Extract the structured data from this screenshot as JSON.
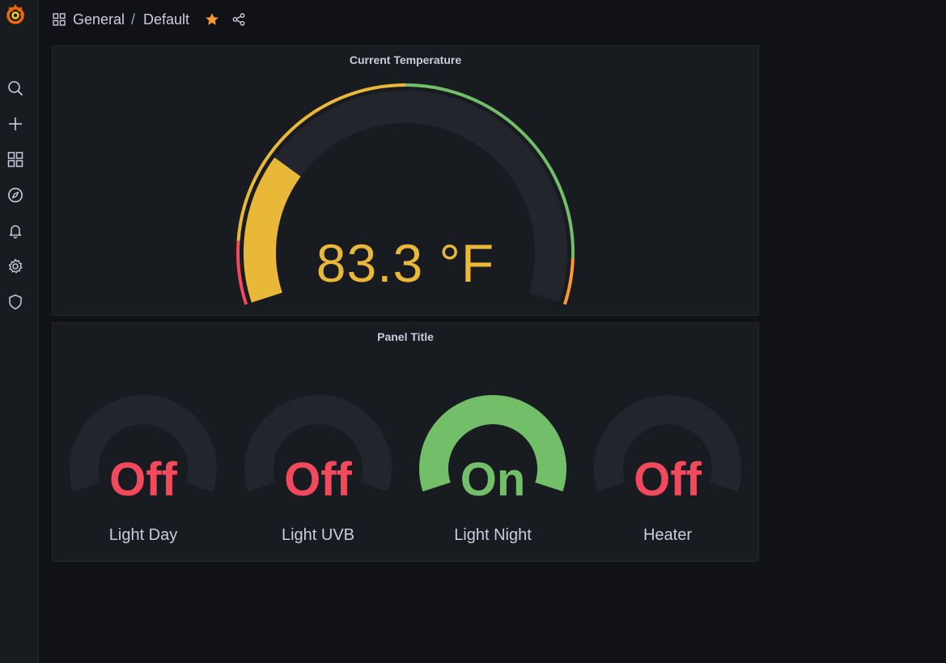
{
  "breadcrumb": {
    "folder": "General",
    "separator": "/",
    "dashboard": "Default"
  },
  "sidebar": {
    "items": [
      {
        "name": "search-icon"
      },
      {
        "name": "plus-icon"
      },
      {
        "name": "dashboards-icon"
      },
      {
        "name": "explore-icon"
      },
      {
        "name": "bell-icon"
      },
      {
        "name": "gear-icon"
      },
      {
        "name": "shield-icon"
      }
    ]
  },
  "colors": {
    "background": "#111217",
    "panel": "#181b1f",
    "yellow": "#eab839",
    "green": "#73bf69",
    "red": "#f2495c",
    "orange": "#ff9830",
    "track": "#22252b",
    "star": "#ff9830"
  },
  "temperature_panel": {
    "title": "Current Temperature",
    "value": "83.3 °F",
    "value_numeric": 83.3,
    "fill_fraction": 0.25
  },
  "status_panel": {
    "title": "Panel Title",
    "items": [
      {
        "name": "Light Day",
        "value": "Off",
        "on": false
      },
      {
        "name": "Light UVB",
        "value": "Off",
        "on": false
      },
      {
        "name": "Light Night",
        "value": "On",
        "on": true
      },
      {
        "name": "Heater",
        "value": "Off",
        "on": false
      }
    ]
  }
}
